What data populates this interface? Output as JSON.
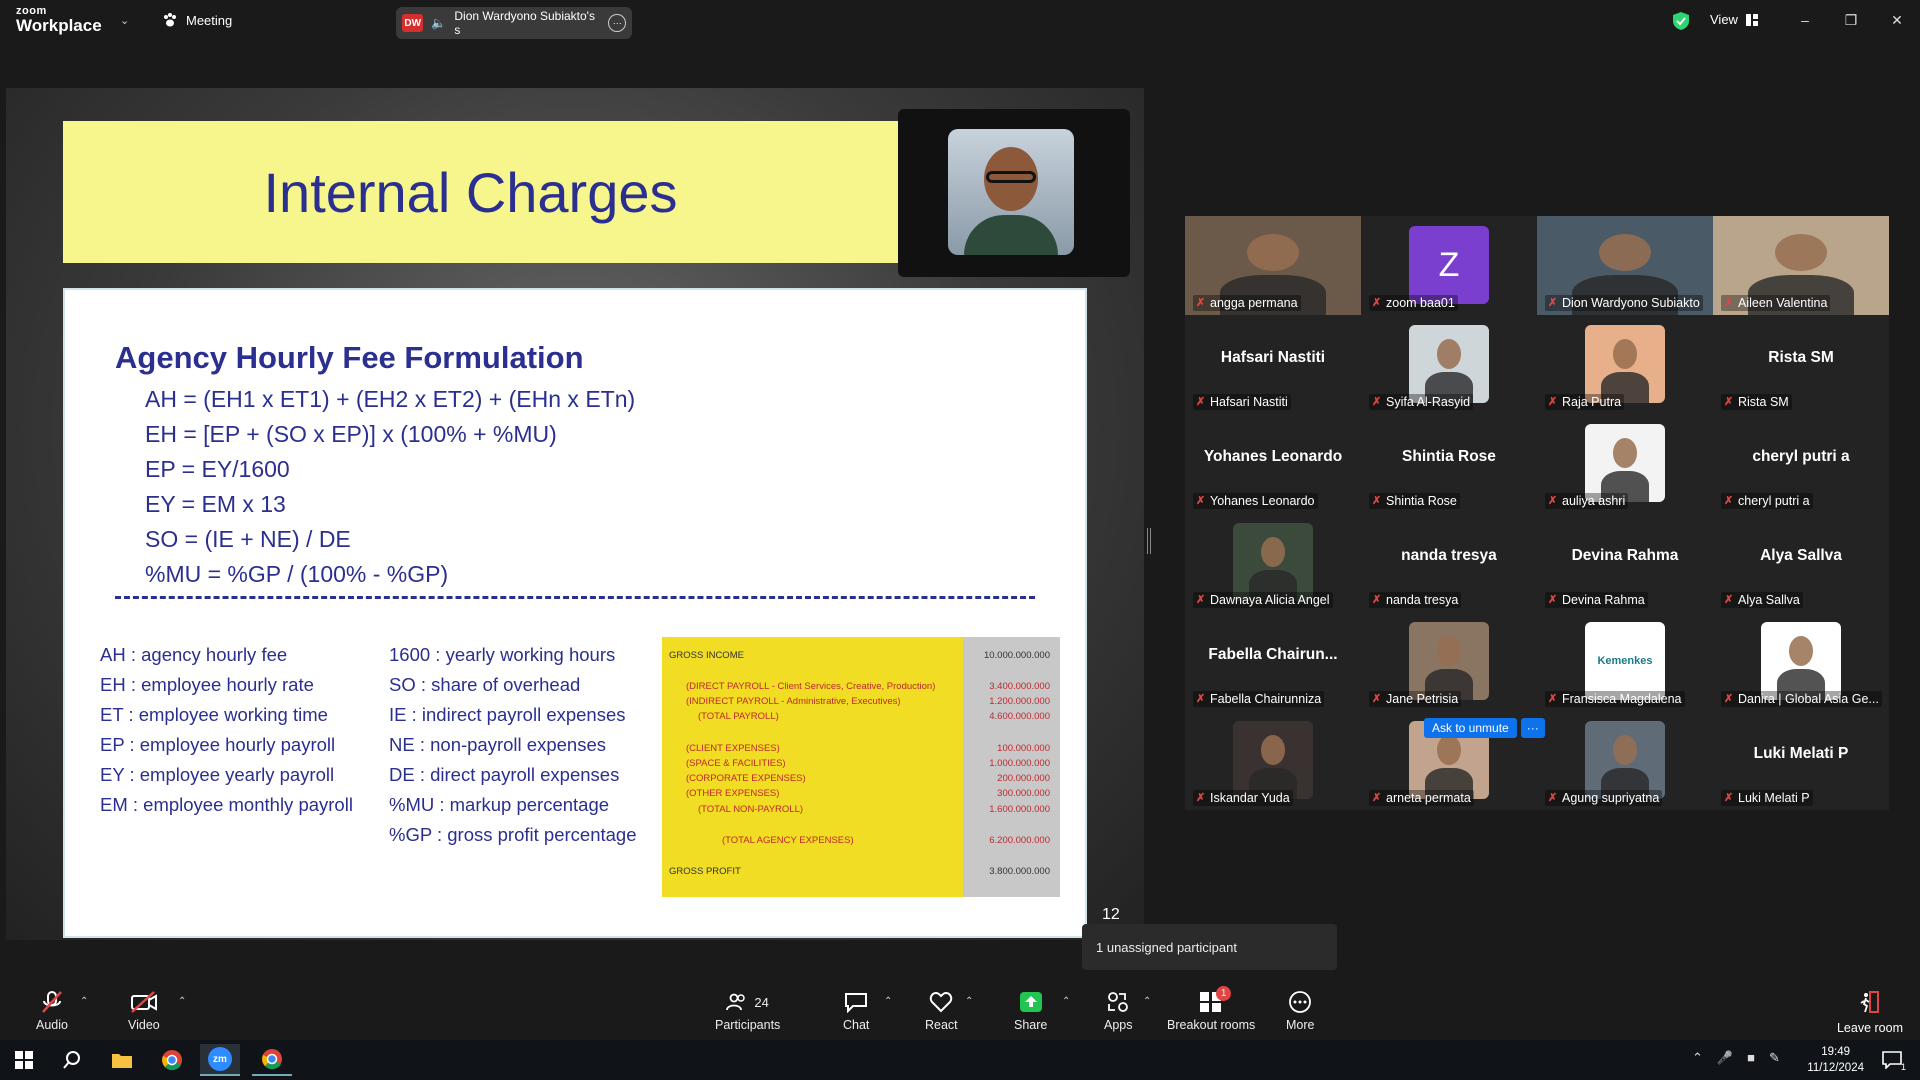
{
  "app": {
    "brand_top": "zoom",
    "brand_bottom": "Workplace"
  },
  "titlebar": {
    "meeting_label": "Meeting",
    "share_avatar": "DW",
    "share_label": "Dion Wardyono Subiakto's s",
    "view_label": "View",
    "accent_green": "#2ed573"
  },
  "slide": {
    "title": "Internal Charges",
    "section_title": "Agency Hourly Fee Formulation",
    "formulas": [
      "AH = (EH1 x ET1) + (EH2 x ET2) + (EHn x ETn)",
      "EH = [EP + (SO x EP)] x (100% + %MU)",
      "EP = EY/1600",
      "EY = EM x 13",
      "SO = (IE + NE) / DE",
      "%MU = %GP / (100% - %GP)"
    ],
    "legend_left": [
      "AH : agency hourly fee",
      "EH : employee hourly rate",
      "ET : employee working time",
      "EP : employee hourly payroll",
      "EY : employee yearly payroll",
      "EM : employee monthly payroll"
    ],
    "legend_right": [
      "1600 : yearly working hours",
      "SO : share of overhead",
      "IE : indirect payroll expenses",
      "NE : non-payroll expenses",
      "DE : direct payroll expenses",
      "%MU : markup percentage",
      "%GP : gross profit percentage"
    ],
    "table": {
      "gross_income": {
        "label": "GROSS INCOME",
        "value": "10.000.000.000"
      },
      "direct_payroll": {
        "label": "(DIRECT PAYROLL - Client Services, Creative, Production)",
        "value": "3.400.000.000"
      },
      "indirect_payroll": {
        "label": "(INDIRECT PAYROLL - Administrative, Executives)",
        "value": "1.200.000.000"
      },
      "total_payroll": {
        "label": "(TOTAL PAYROLL)",
        "value": "4.600.000.000"
      },
      "client_expenses": {
        "label": "(CLIENT EXPENSES)",
        "value": "100.000.000"
      },
      "space_facilities": {
        "label": "(SPACE & FACILITIES)",
        "value": "1.000.000.000"
      },
      "corporate_expenses": {
        "label": "(CORPORATE EXPENSES)",
        "value": "200.000.000"
      },
      "other_expenses": {
        "label": "(OTHER EXPENSES)",
        "value": "300.000.000"
      },
      "total_non_payroll": {
        "label": "(TOTAL NON-PAYROLL)",
        "value": "1.600.000.000"
      },
      "total_agency": {
        "label": "(TOTAL AGENCY EXPENSES)",
        "value": "6.200.000.000"
      },
      "gross_profit": {
        "label": "GROSS PROFIT",
        "value": "3.800.000.000"
      }
    },
    "page_number": "12"
  },
  "gallery": [
    {
      "name": "angga permana",
      "big": ""
    },
    {
      "name": "zoom baa01",
      "big": "",
      "avatar_letter": "Z"
    },
    {
      "name": "Dion Wardyono Subiakto",
      "big": "",
      "active": true
    },
    {
      "name": "Aileen Valentina",
      "big": ""
    },
    {
      "name": "Hafsari Nastiti",
      "big": "Hafsari Nastiti"
    },
    {
      "name": "Syifa Al-Rasyid",
      "big": ""
    },
    {
      "name": "Raja Putra",
      "big": ""
    },
    {
      "name": "Rista SM",
      "big": "Rista SM"
    },
    {
      "name": "Yohanes Leonardo",
      "big": "Yohanes Leonardo"
    },
    {
      "name": "Shintia Rose",
      "big": "Shintia Rose"
    },
    {
      "name": "auliya ashri",
      "big": ""
    },
    {
      "name": "cheryl putri a",
      "big": "cheryl putri a"
    },
    {
      "name": "Dawnaya Alicia Angel",
      "big": ""
    },
    {
      "name": "nanda tresya",
      "big": "nanda tresya"
    },
    {
      "name": "Devina Rahma",
      "big": "Devina Rahma"
    },
    {
      "name": "Alya Sallva",
      "big": "Alya Sallva"
    },
    {
      "name": "Fabella Chairunniza",
      "big": "Fabella  Chairun..."
    },
    {
      "name": "Jane Petrisia",
      "big": ""
    },
    {
      "name": "Fransisca Magdalena",
      "big": "",
      "thumb_text": "Kemenkes"
    },
    {
      "name": "Danira | Global Asia Ge...",
      "big": ""
    },
    {
      "name": "Iskandar Yuda",
      "big": ""
    },
    {
      "name": "arneta permata",
      "big": ""
    },
    {
      "name": "Agung supriyatna",
      "big": ""
    },
    {
      "name": "Luki Melati P",
      "big": "Luki Melati P"
    }
  ],
  "popups": {
    "ask_unmute": "Ask to unmute",
    "more": "···",
    "unassigned": "1 unassigned participant"
  },
  "toolbar": {
    "audio": "Audio",
    "video": "Video",
    "participants": "Participants",
    "participant_count": "24",
    "chat": "Chat",
    "react": "React",
    "share": "Share",
    "apps": "Apps",
    "breakout": "Breakout rooms",
    "breakout_badge": "1",
    "more": "More",
    "leave": "Leave room"
  },
  "taskbar": {
    "time": "19:49",
    "date": "11/12/2024",
    "notif_count": "1"
  }
}
